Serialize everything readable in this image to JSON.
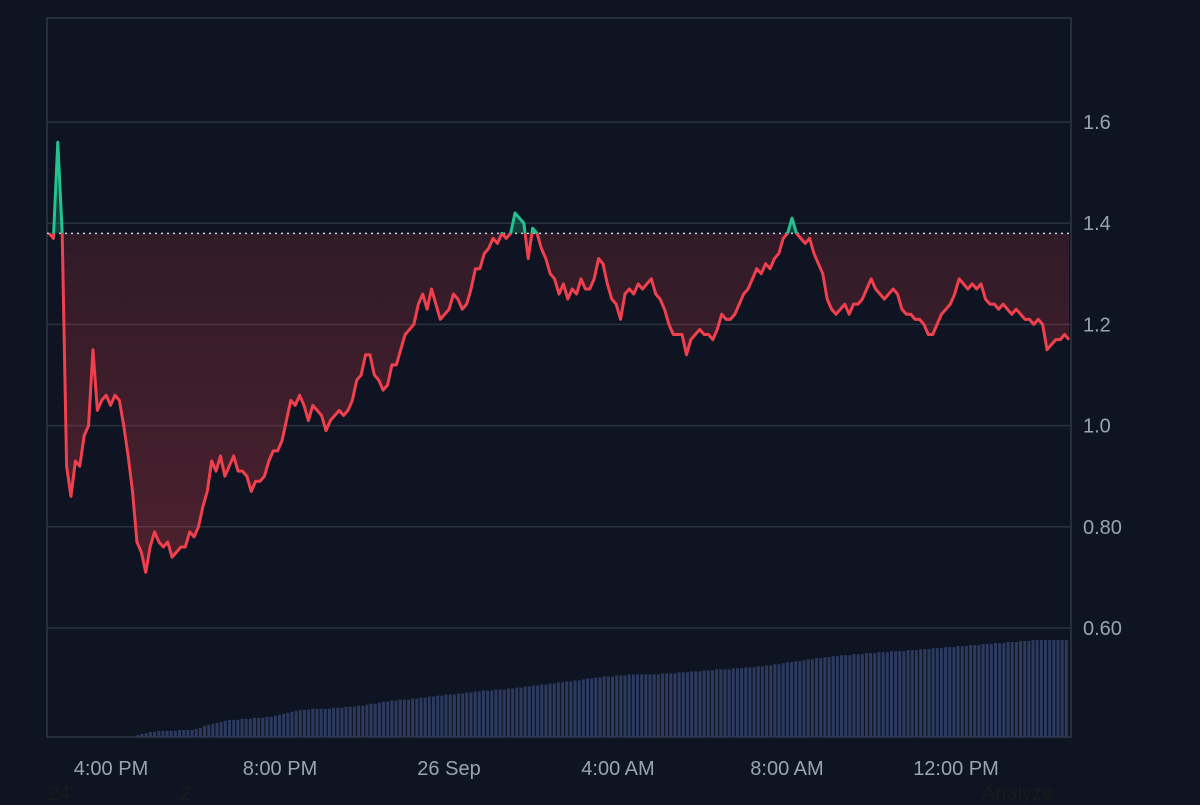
{
  "chart_data": {
    "type": "line",
    "title": "",
    "xlabel": "",
    "ylabel": "",
    "ylim": [
      0.4,
      1.8
    ],
    "y_ticks": [
      {
        "value": 0.6,
        "label": "0.60"
      },
      {
        "value": 0.8,
        "label": "0.80"
      },
      {
        "value": 1.0,
        "label": "1.0"
      },
      {
        "value": 1.2,
        "label": "1.2"
      },
      {
        "value": 1.4,
        "label": "1.4"
      },
      {
        "value": 1.6,
        "label": "1.6"
      }
    ],
    "x_ticks": [
      "4:00 PM",
      "8:00 PM",
      "26 Sep",
      "4:00 AM",
      "8:00 AM",
      "12:00 PM"
    ],
    "baseline": 1.38,
    "grid": true,
    "colors": {
      "above": "#22c38e",
      "below": "#f0404e",
      "volume": "#2c3a60",
      "grid": "#2a3140",
      "baseline": "#d0d4dc",
      "background": "#0e1421"
    },
    "series": [
      {
        "values": [
          1.38,
          1.37,
          1.56,
          1.38,
          0.92,
          0.86,
          0.93,
          0.92,
          0.98,
          1.0,
          1.15,
          1.03,
          1.05,
          1.06,
          1.04,
          1.06,
          1.05,
          1.0,
          0.94,
          0.87,
          0.77,
          0.75,
          0.71,
          0.76,
          0.79,
          0.77,
          0.76,
          0.77,
          0.74,
          0.75,
          0.76,
          0.76,
          0.79,
          0.78,
          0.8,
          0.84,
          0.87,
          0.93,
          0.91,
          0.94,
          0.9,
          0.92,
          0.94,
          0.91,
          0.91,
          0.9,
          0.87,
          0.89,
          0.89,
          0.9,
          0.93,
          0.95,
          0.95,
          0.97,
          1.01,
          1.05,
          1.04,
          1.06,
          1.04,
          1.01,
          1.04,
          1.03,
          1.02,
          0.99,
          1.01,
          1.02,
          1.03,
          1.02,
          1.03,
          1.05,
          1.09,
          1.1,
          1.14,
          1.14,
          1.1,
          1.09,
          1.07,
          1.08,
          1.12,
          1.12,
          1.15,
          1.18,
          1.19,
          1.2,
          1.24,
          1.26,
          1.23,
          1.27,
          1.24,
          1.21,
          1.22,
          1.23,
          1.26,
          1.25,
          1.23,
          1.24,
          1.27,
          1.31,
          1.31,
          1.34,
          1.35,
          1.37,
          1.36,
          1.38,
          1.37,
          1.38,
          1.42,
          1.41,
          1.4,
          1.33,
          1.39,
          1.38,
          1.35,
          1.33,
          1.3,
          1.29,
          1.26,
          1.28,
          1.25,
          1.27,
          1.26,
          1.29,
          1.27,
          1.27,
          1.29,
          1.33,
          1.32,
          1.28,
          1.25,
          1.24,
          1.21,
          1.26,
          1.27,
          1.26,
          1.28,
          1.27,
          1.28,
          1.29,
          1.26,
          1.25,
          1.23,
          1.2,
          1.18,
          1.18,
          1.18,
          1.14,
          1.17,
          1.18,
          1.19,
          1.18,
          1.18,
          1.17,
          1.19,
          1.22,
          1.21,
          1.21,
          1.22,
          1.24,
          1.26,
          1.27,
          1.29,
          1.31,
          1.3,
          1.32,
          1.31,
          1.33,
          1.34,
          1.37,
          1.38,
          1.41,
          1.38,
          1.37,
          1.36,
          1.37,
          1.34,
          1.32,
          1.3,
          1.25,
          1.23,
          1.22,
          1.23,
          1.24,
          1.22,
          1.24,
          1.24,
          1.25,
          1.27,
          1.29,
          1.27,
          1.26,
          1.25,
          1.26,
          1.27,
          1.26,
          1.23,
          1.22,
          1.22,
          1.21,
          1.21,
          1.2,
          1.18,
          1.18,
          1.2,
          1.22,
          1.23,
          1.24,
          1.26,
          1.29,
          1.28,
          1.27,
          1.28,
          1.27,
          1.28,
          1.25,
          1.24,
          1.24,
          1.23,
          1.24,
          1.23,
          1.22,
          1.23,
          1.22,
          1.21,
          1.21,
          1.2,
          1.21,
          1.2,
          1.15,
          1.16,
          1.17,
          1.17,
          1.18,
          1.17
        ]
      }
    ],
    "volume": {
      "max": 1.0,
      "values": [
        0,
        0,
        0,
        0,
        0,
        0,
        0,
        0,
        0,
        0,
        0,
        0,
        0,
        0,
        0,
        0,
        0,
        0,
        0,
        0,
        0,
        0.02,
        0.03,
        0.04,
        0.05,
        0.05,
        0.06,
        0.06,
        0.06,
        0.06,
        0.06,
        0.07,
        0.07,
        0.07,
        0.07,
        0.08,
        0.09,
        0.11,
        0.12,
        0.13,
        0.14,
        0.15,
        0.16,
        0.17,
        0.17,
        0.17,
        0.18,
        0.18,
        0.18,
        0.19,
        0.19,
        0.19,
        0.2,
        0.2,
        0.21,
        0.22,
        0.23,
        0.24,
        0.25,
        0.26,
        0.27,
        0.27,
        0.27,
        0.28,
        0.28,
        0.28,
        0.28,
        0.28,
        0.29,
        0.29,
        0.29,
        0.3,
        0.3,
        0.3,
        0.31,
        0.31,
        0.32,
        0.33,
        0.33,
        0.34,
        0.35,
        0.35,
        0.36,
        0.36,
        0.37,
        0.37,
        0.37,
        0.38,
        0.38,
        0.39,
        0.39,
        0.4,
        0.4,
        0.41,
        0.41,
        0.42,
        0.42,
        0.42,
        0.43,
        0.43,
        0.44,
        0.44,
        0.45,
        0.45,
        0.46,
        0.46,
        0.46,
        0.47,
        0.47,
        0.47,
        0.48,
        0.48,
        0.49,
        0.49,
        0.5,
        0.5,
        0.51,
        0.51,
        0.52,
        0.52,
        0.53,
        0.53,
        0.54,
        0.54,
        0.55,
        0.55,
        0.56,
        0.56,
        0.57,
        0.58,
        0.58,
        0.59,
        0.59,
        0.6,
        0.6,
        0.6,
        0.61,
        0.61,
        0.61,
        0.62,
        0.62,
        0.62,
        0.62,
        0.62,
        0.62,
        0.62,
        0.62,
        0.63,
        0.63,
        0.63,
        0.63,
        0.64,
        0.64,
        0.64,
        0.65,
        0.65,
        0.65,
        0.66,
        0.66,
        0.66,
        0.67,
        0.67,
        0.67,
        0.67,
        0.68,
        0.68,
        0.68,
        0.69,
        0.69,
        0.69,
        0.7,
        0.7,
        0.71,
        0.71,
        0.72,
        0.72,
        0.73,
        0.74,
        0.74,
        0.75,
        0.75,
        0.76,
        0.77,
        0.77,
        0.78,
        0.78,
        0.79,
        0.79,
        0.8,
        0.8,
        0.81,
        0.81,
        0.81,
        0.82,
        0.82,
        0.82,
        0.83,
        0.83,
        0.83,
        0.84,
        0.84,
        0.84,
        0.85,
        0.85,
        0.85,
        0.85,
        0.86,
        0.86,
        0.86,
        0.87,
        0.87,
        0.87,
        0.88,
        0.88,
        0.88,
        0.89,
        0.89,
        0.89,
        0.9,
        0.9,
        0.9,
        0.91,
        0.91,
        0.91,
        0.92,
        0.92,
        0.92,
        0.93,
        0.93,
        0.93,
        0.94,
        0.94,
        0.94,
        0.95,
        0.95,
        0.95,
        0.96,
        0.96,
        0.96,
        0.96,
        0.96,
        0.96,
        0.96,
        0.96,
        0.96
      ]
    }
  },
  "footer": {
    "left_text_1": "24",
    "left_text_2": "2",
    "right_text": "Analyze"
  }
}
